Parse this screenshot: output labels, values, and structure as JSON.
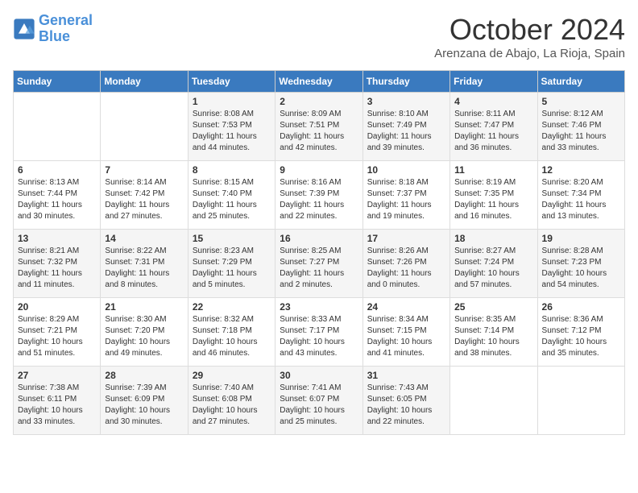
{
  "header": {
    "logo_line1": "General",
    "logo_line2": "Blue",
    "month": "October 2024",
    "location": "Arenzana de Abajo, La Rioja, Spain"
  },
  "days_of_week": [
    "Sunday",
    "Monday",
    "Tuesday",
    "Wednesday",
    "Thursday",
    "Friday",
    "Saturday"
  ],
  "weeks": [
    [
      {
        "day": "",
        "content": ""
      },
      {
        "day": "",
        "content": ""
      },
      {
        "day": "1",
        "content": "Sunrise: 8:08 AM\nSunset: 7:53 PM\nDaylight: 11 hours and 44 minutes."
      },
      {
        "day": "2",
        "content": "Sunrise: 8:09 AM\nSunset: 7:51 PM\nDaylight: 11 hours and 42 minutes."
      },
      {
        "day": "3",
        "content": "Sunrise: 8:10 AM\nSunset: 7:49 PM\nDaylight: 11 hours and 39 minutes."
      },
      {
        "day": "4",
        "content": "Sunrise: 8:11 AM\nSunset: 7:47 PM\nDaylight: 11 hours and 36 minutes."
      },
      {
        "day": "5",
        "content": "Sunrise: 8:12 AM\nSunset: 7:46 PM\nDaylight: 11 hours and 33 minutes."
      }
    ],
    [
      {
        "day": "6",
        "content": "Sunrise: 8:13 AM\nSunset: 7:44 PM\nDaylight: 11 hours and 30 minutes."
      },
      {
        "day": "7",
        "content": "Sunrise: 8:14 AM\nSunset: 7:42 PM\nDaylight: 11 hours and 27 minutes."
      },
      {
        "day": "8",
        "content": "Sunrise: 8:15 AM\nSunset: 7:40 PM\nDaylight: 11 hours and 25 minutes."
      },
      {
        "day": "9",
        "content": "Sunrise: 8:16 AM\nSunset: 7:39 PM\nDaylight: 11 hours and 22 minutes."
      },
      {
        "day": "10",
        "content": "Sunrise: 8:18 AM\nSunset: 7:37 PM\nDaylight: 11 hours and 19 minutes."
      },
      {
        "day": "11",
        "content": "Sunrise: 8:19 AM\nSunset: 7:35 PM\nDaylight: 11 hours and 16 minutes."
      },
      {
        "day": "12",
        "content": "Sunrise: 8:20 AM\nSunset: 7:34 PM\nDaylight: 11 hours and 13 minutes."
      }
    ],
    [
      {
        "day": "13",
        "content": "Sunrise: 8:21 AM\nSunset: 7:32 PM\nDaylight: 11 hours and 11 minutes."
      },
      {
        "day": "14",
        "content": "Sunrise: 8:22 AM\nSunset: 7:31 PM\nDaylight: 11 hours and 8 minutes."
      },
      {
        "day": "15",
        "content": "Sunrise: 8:23 AM\nSunset: 7:29 PM\nDaylight: 11 hours and 5 minutes."
      },
      {
        "day": "16",
        "content": "Sunrise: 8:25 AM\nSunset: 7:27 PM\nDaylight: 11 hours and 2 minutes."
      },
      {
        "day": "17",
        "content": "Sunrise: 8:26 AM\nSunset: 7:26 PM\nDaylight: 11 hours and 0 minutes."
      },
      {
        "day": "18",
        "content": "Sunrise: 8:27 AM\nSunset: 7:24 PM\nDaylight: 10 hours and 57 minutes."
      },
      {
        "day": "19",
        "content": "Sunrise: 8:28 AM\nSunset: 7:23 PM\nDaylight: 10 hours and 54 minutes."
      }
    ],
    [
      {
        "day": "20",
        "content": "Sunrise: 8:29 AM\nSunset: 7:21 PM\nDaylight: 10 hours and 51 minutes."
      },
      {
        "day": "21",
        "content": "Sunrise: 8:30 AM\nSunset: 7:20 PM\nDaylight: 10 hours and 49 minutes."
      },
      {
        "day": "22",
        "content": "Sunrise: 8:32 AM\nSunset: 7:18 PM\nDaylight: 10 hours and 46 minutes."
      },
      {
        "day": "23",
        "content": "Sunrise: 8:33 AM\nSunset: 7:17 PM\nDaylight: 10 hours and 43 minutes."
      },
      {
        "day": "24",
        "content": "Sunrise: 8:34 AM\nSunset: 7:15 PM\nDaylight: 10 hours and 41 minutes."
      },
      {
        "day": "25",
        "content": "Sunrise: 8:35 AM\nSunset: 7:14 PM\nDaylight: 10 hours and 38 minutes."
      },
      {
        "day": "26",
        "content": "Sunrise: 8:36 AM\nSunset: 7:12 PM\nDaylight: 10 hours and 35 minutes."
      }
    ],
    [
      {
        "day": "27",
        "content": "Sunrise: 7:38 AM\nSunset: 6:11 PM\nDaylight: 10 hours and 33 minutes."
      },
      {
        "day": "28",
        "content": "Sunrise: 7:39 AM\nSunset: 6:09 PM\nDaylight: 10 hours and 30 minutes."
      },
      {
        "day": "29",
        "content": "Sunrise: 7:40 AM\nSunset: 6:08 PM\nDaylight: 10 hours and 27 minutes."
      },
      {
        "day": "30",
        "content": "Sunrise: 7:41 AM\nSunset: 6:07 PM\nDaylight: 10 hours and 25 minutes."
      },
      {
        "day": "31",
        "content": "Sunrise: 7:43 AM\nSunset: 6:05 PM\nDaylight: 10 hours and 22 minutes."
      },
      {
        "day": "",
        "content": ""
      },
      {
        "day": "",
        "content": ""
      }
    ]
  ]
}
